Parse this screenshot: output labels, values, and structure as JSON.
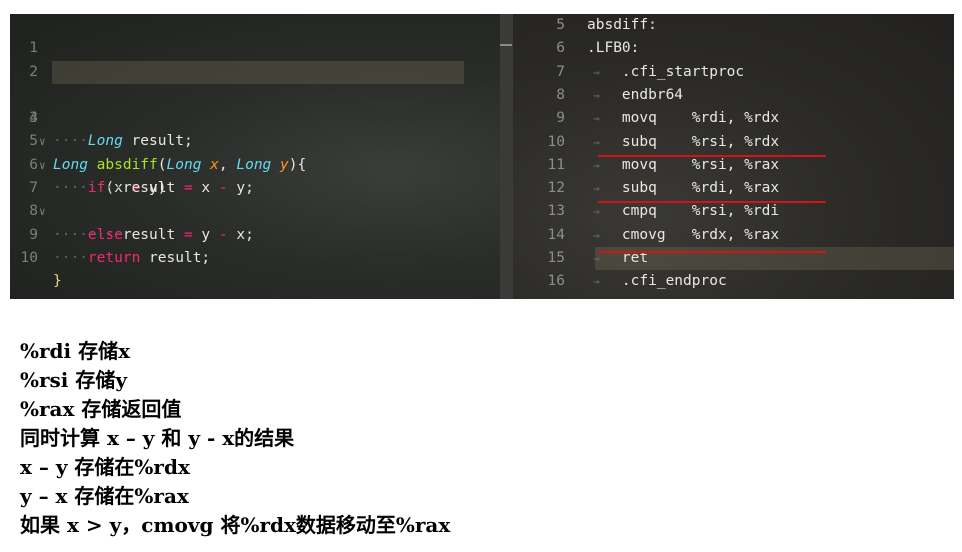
{
  "left_editor": {
    "lines": [
      {
        "n": "1"
      },
      {
        "n": "2"
      },
      {
        "n": "3",
        "fold": "∨",
        "highlight": true,
        "t1": "Long",
        "t2": " ",
        "t3": "absdiff",
        "t4": "(",
        "t5": "Long",
        "t6": " ",
        "t7": "x",
        "t8": ", ",
        "t9": "Long",
        "t10": " ",
        "t11": "y",
        "t12": "){"
      },
      {
        "n": "4",
        "ind": "····",
        "t1": "Long",
        "t2": " result;"
      },
      {
        "n": "5",
        "fold": "∨",
        "ind": "····",
        "t1": "if",
        "t2": "(x ",
        "t3": ">",
        "t4": " y)"
      },
      {
        "n": "6",
        "ind": "········",
        "t1": "result ",
        "t2": "=",
        "t3": " x ",
        "t4": "-",
        "t5": " y;"
      },
      {
        "n": "7",
        "fold": "∨",
        "ind": "····",
        "t1": "else"
      },
      {
        "n": "8",
        "ind": "········",
        "t1": "result ",
        "t2": "=",
        "t3": " y ",
        "t4": "-",
        "t5": " x;"
      },
      {
        "n": "9",
        "ind": "····",
        "t1": "return",
        "t2": " result;"
      },
      {
        "n": "10",
        "t1": "}"
      }
    ]
  },
  "right_editor": {
    "arrow": "→",
    "lines": [
      {
        "n": "5",
        "code": "absdiff:"
      },
      {
        "n": "6",
        "code": ".LFB0:"
      },
      {
        "n": "7",
        "code": "    .cfi_startproc"
      },
      {
        "n": "8",
        "code": "    endbr64"
      },
      {
        "n": "9",
        "code": "    movq    %rdi, %rdx"
      },
      {
        "n": "10",
        "code": "    subq    %rsi, %rdx"
      },
      {
        "n": "11",
        "code": "    movq    %rsi, %rax"
      },
      {
        "n": "12",
        "code": "    subq    %rdi, %rax"
      },
      {
        "n": "13",
        "code": "    cmpq    %rsi, %rdi"
      },
      {
        "n": "14",
        "code": "    cmovg   %rdx, %rax"
      },
      {
        "n": "15",
        "code": "    ret"
      },
      {
        "n": "16",
        "code": "    .cfi_endproc"
      }
    ]
  },
  "notes": [
    "%rdi 存储x",
    "%rsi 存储y",
    "%rax 存储返回值",
    "同时计算 x – y 和 y - x的结果",
    "x – y 存储在%rdx",
    "y – x 存储在%rax",
    "如果 x > y，cmovg 将%rdx数据移动至%rax"
  ],
  "colors": {
    "annotation_line": "#d01515",
    "keyword": "#66d9ef",
    "function": "#a6e22e",
    "param": "#fd971f",
    "operator": "#f92672"
  }
}
